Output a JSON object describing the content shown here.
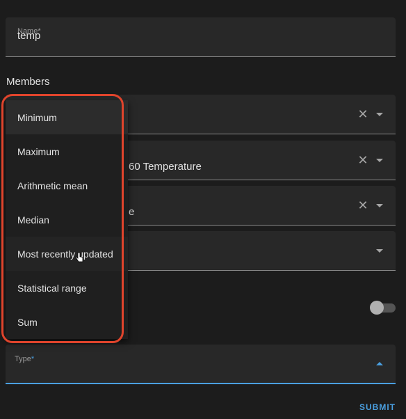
{
  "name_field": {
    "label": "Name*",
    "value": "temp"
  },
  "members": {
    "label": "Members",
    "entities": [
      {
        "value": "",
        "has_clear": true
      },
      {
        "value": "60 Temperature",
        "has_clear": true
      },
      {
        "value": "e",
        "has_clear": true
      },
      {
        "value": "",
        "has_clear": false
      }
    ]
  },
  "toggle": {
    "state": "off"
  },
  "type_field": {
    "label": "Type",
    "required_mark": "*"
  },
  "submit_label": "SUBMIT",
  "type_menu": {
    "items": [
      {
        "label": "Minimum"
      },
      {
        "label": "Maximum"
      },
      {
        "label": "Arithmetic mean"
      },
      {
        "label": "Median"
      },
      {
        "label": "Most recently updated"
      },
      {
        "label": "Statistical range"
      },
      {
        "label": "Sum"
      }
    ]
  },
  "colors": {
    "accent": "#4a9fe0",
    "highlight": "#e0442c",
    "background": "#1c1c1c"
  }
}
